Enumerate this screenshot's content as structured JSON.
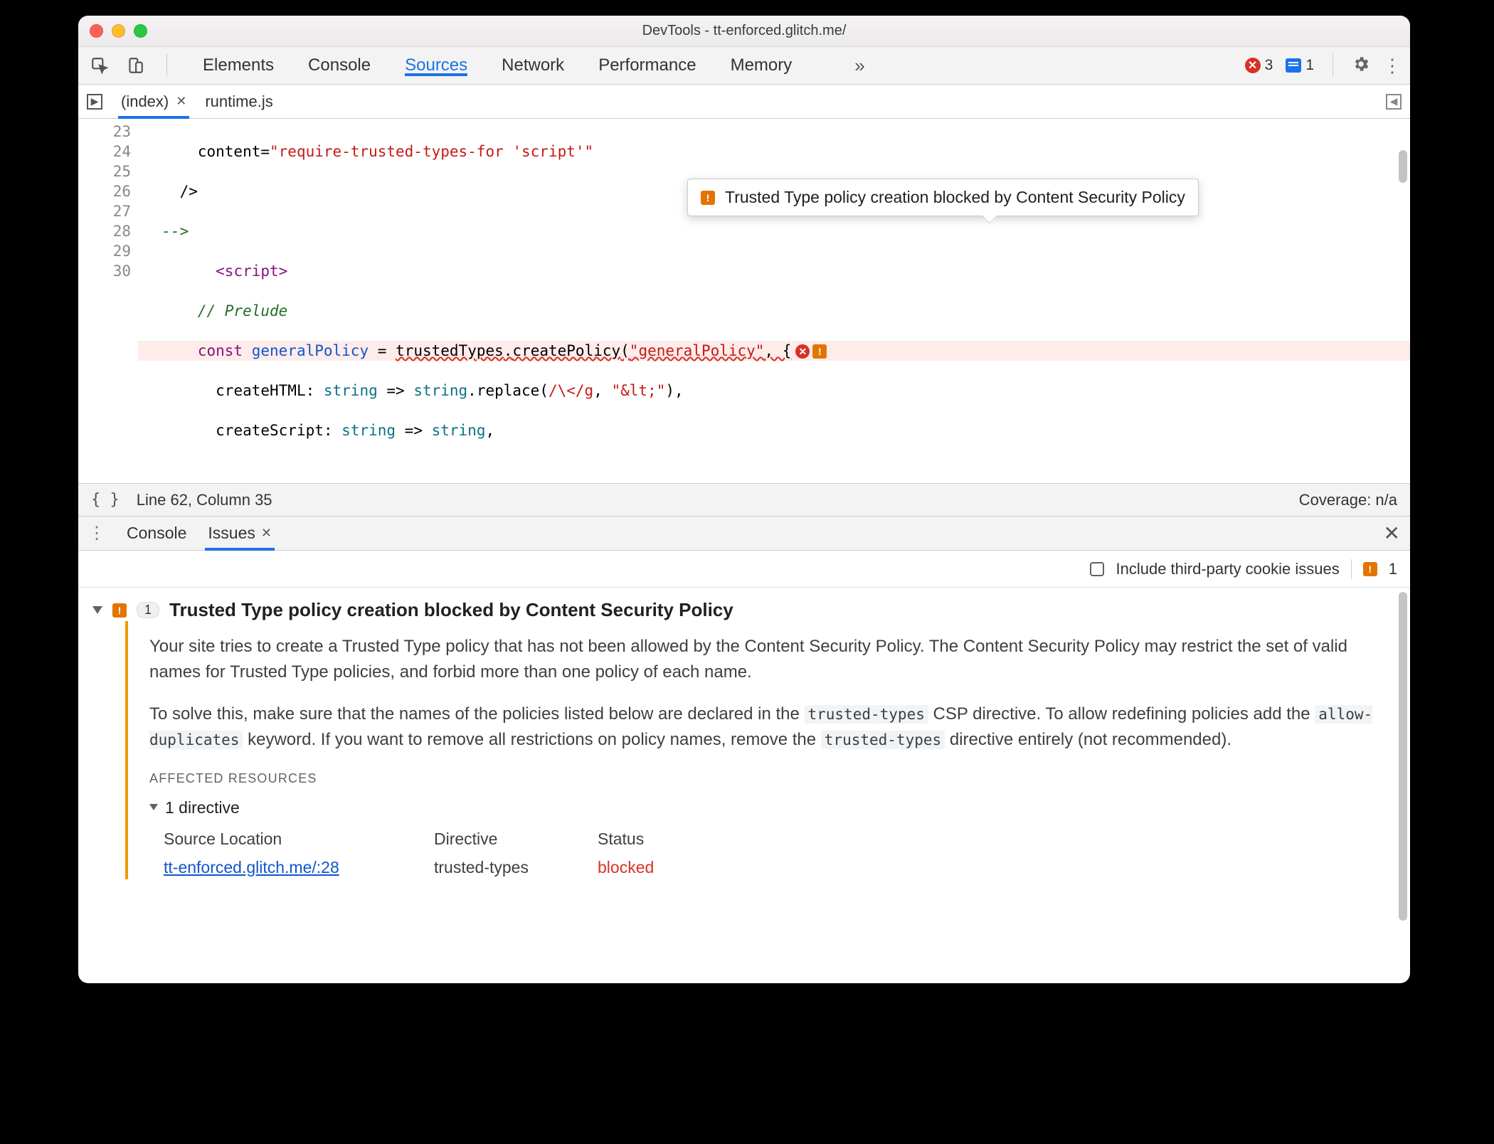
{
  "window": {
    "title": "DevTools - tt-enforced.glitch.me/"
  },
  "mainTabs": {
    "elements": "Elements",
    "console": "Console",
    "sources": "Sources",
    "network": "Network",
    "performance": "Performance",
    "memory": "Memory",
    "more": "»"
  },
  "counters": {
    "errors": "3",
    "messages": "1"
  },
  "fileTabs": {
    "index": "(index)",
    "runtime": "runtime.js"
  },
  "code": {
    "gutter": [
      "23",
      "24",
      "25",
      "26",
      "27",
      "28",
      "29",
      "30"
    ],
    "l23a": "      content=",
    "l23b": "\"require-trusted-types-for 'script'\"",
    "l24": "    />",
    "l25": "  -->",
    "l26pad": "        ",
    "l26a": "<script",
    "l26b": ">",
    "l27pad": "      ",
    "l27": "// Prelude",
    "l28pad": "      ",
    "l28a": "const",
    "l28sp1": " ",
    "l28b": "generalPolicy",
    "l28c": " = ",
    "l28d": "trustedTypes",
    "l28e": ".",
    "l28f": "createPolicy",
    "l28g": "(",
    "l28h": "\"generalPolicy\"",
    "l28i": ", {",
    "l29pad": "        ",
    "l29a": "createHTML: ",
    "l29b": "string",
    "l29c": " => ",
    "l29d": "string",
    "l29e": ".replace(",
    "l29f": "/\\</g",
    "l29g": ", ",
    "l29h": "\"&lt;\"",
    "l29i": "),",
    "l30pad": "        ",
    "l30a": "createScript: ",
    "l30b": "string",
    "l30c": " => ",
    "l30d": "string",
    "l30e": ","
  },
  "tooltip": "Trusted Type policy creation blocked by Content Security Policy",
  "status": {
    "pos": "Line 62, Column 35",
    "coverage": "Coverage: n/a"
  },
  "drawer": {
    "console": "Console",
    "issues": "Issues"
  },
  "issuesBar": {
    "thirdParty": "Include third-party cookie issues",
    "count": "1"
  },
  "issue": {
    "count": "1",
    "title": "Trusted Type policy creation blocked by Content Security Policy",
    "p1": "Your site tries to create a Trusted Type policy that has not been allowed by the Content Security Policy. The Content Security Policy may restrict the set of valid names for Trusted Type policies, and forbid more than one policy of each name.",
    "p2a": "To solve this, make sure that the names of the policies listed below are declared in the ",
    "p2code1": "trusted-types",
    "p2b": " CSP directive. To allow redefining policies add the ",
    "p2code2": "allow-duplicates",
    "p2c": " keyword. If you want to remove all restrictions on policy names, remove the ",
    "p2code3": "trusted-types",
    "p2d": " directive entirely (not recommended).",
    "affected": "AFFECTED RESOURCES",
    "dirCount": "1 directive",
    "th1": "Source Location",
    "th2": "Directive",
    "th3": "Status",
    "td1": "tt-enforced.glitch.me/:28",
    "td2": "trusted-types",
    "td3": "blocked"
  }
}
